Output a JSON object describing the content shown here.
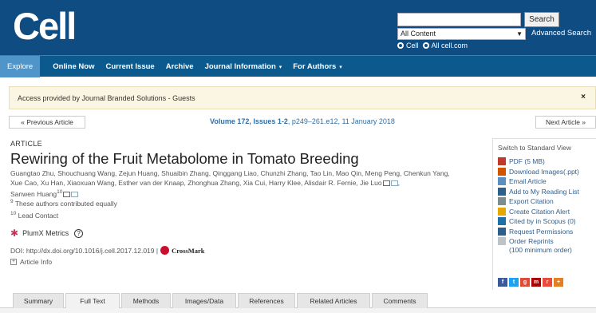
{
  "header": {
    "logo": "Cell",
    "search_value": "",
    "search_button": "Search",
    "scope_selected": "All Content",
    "advanced_search": "Advanced Search",
    "radio_cell": "Cell",
    "radio_all": "All cell.com"
  },
  "nav": {
    "items": [
      "Explore",
      "Online Now",
      "Current Issue",
      "Archive",
      "Journal Information",
      "For Authors"
    ]
  },
  "access": {
    "text": "Access provided by Journal Branded Solutions - Guests",
    "close": "×"
  },
  "article_nav": {
    "prev": "« Previous Article",
    "next": "Next Article »",
    "volume": "Volume 172, Issues 1-2",
    "volume_rest": ", p249–261.e12, 11 January 2018"
  },
  "article": {
    "label": "ARTICLE",
    "title": "Rewiring of the Fruit Metabolome in Tomato Breeding",
    "authors_line1": "Guangtao Zhu, Shouchuang Wang, Zejun Huang, Shuaibin Zhang, Qinggang Liao, Chunzhi Zhang, Tao Lin, Mao Qin, Meng Peng, Chenkun Yang,",
    "authors_line2": "Xue Cao, Xu Han, Xiaoxuan Wang, Esther van der Knaap, Zhonghua Zhang, Xia Cui, Harry Klee, Alisdair R. Fernie, Jie Luo",
    "authors_line3": "Sanwen Huang",
    "sup9": "9",
    "sup10": "10",
    "footnote1": "These authors contributed equally",
    "footnote2": "Lead Contact",
    "plumx": "PlumX Metrics",
    "info_mark": "?",
    "doi": "DOI: http://dx.doi.org/10.1016/j.cell.2017.12.019 |",
    "crossmark": "CrossMark",
    "article_info": "Article Info"
  },
  "sidebar": {
    "switch": "Switch to Standard View",
    "tools": [
      {
        "label": "PDF (5 MB)",
        "icon": "pdf-icon",
        "color": "#c0392b"
      },
      {
        "label": "Download Images(.ppt)",
        "icon": "ppt-icon",
        "color": "#d35400"
      },
      {
        "label": "Email Article",
        "icon": "email-icon",
        "color": "#5a8fc2"
      },
      {
        "label": "Add to My Reading List",
        "icon": "reading-list-icon",
        "color": "#2c5f8a"
      },
      {
        "label": "Export Citation",
        "icon": "export-icon",
        "color": "#7f8c8d"
      },
      {
        "label": "Create Citation Alert",
        "icon": "alert-icon",
        "color": "#e6a700"
      },
      {
        "label": "Cited by in Scopus (0)",
        "icon": "scopus-icon",
        "color": "#1f6fa8"
      },
      {
        "label": "Request Permissions",
        "icon": "permissions-icon",
        "color": "#2c5f8a"
      }
    ],
    "reprints_line1": "Order Reprints",
    "reprints_line2": "(100 minimum order)",
    "social": [
      {
        "name": "facebook-icon",
        "glyph": "f",
        "color": "#3b5998"
      },
      {
        "name": "twitter-icon",
        "glyph": "t",
        "color": "#1da1f2"
      },
      {
        "name": "google-plus-icon",
        "glyph": "g",
        "color": "#dd4b39"
      },
      {
        "name": "mendeley-icon",
        "glyph": "m",
        "color": "#a00"
      },
      {
        "name": "reddit-icon",
        "glyph": "r",
        "color": "#e74c3c"
      },
      {
        "name": "more-share-icon",
        "glyph": "+",
        "color": "#e67e22"
      }
    ]
  },
  "tabs": [
    "Summary",
    "Full Text",
    "Methods",
    "Images/Data",
    "References",
    "Related Articles",
    "Comments"
  ],
  "colors": {
    "header": "#0f4c81",
    "nav": "#0c5a8d",
    "nav_active": "#4f95c9",
    "link": "#2f6ea6"
  }
}
